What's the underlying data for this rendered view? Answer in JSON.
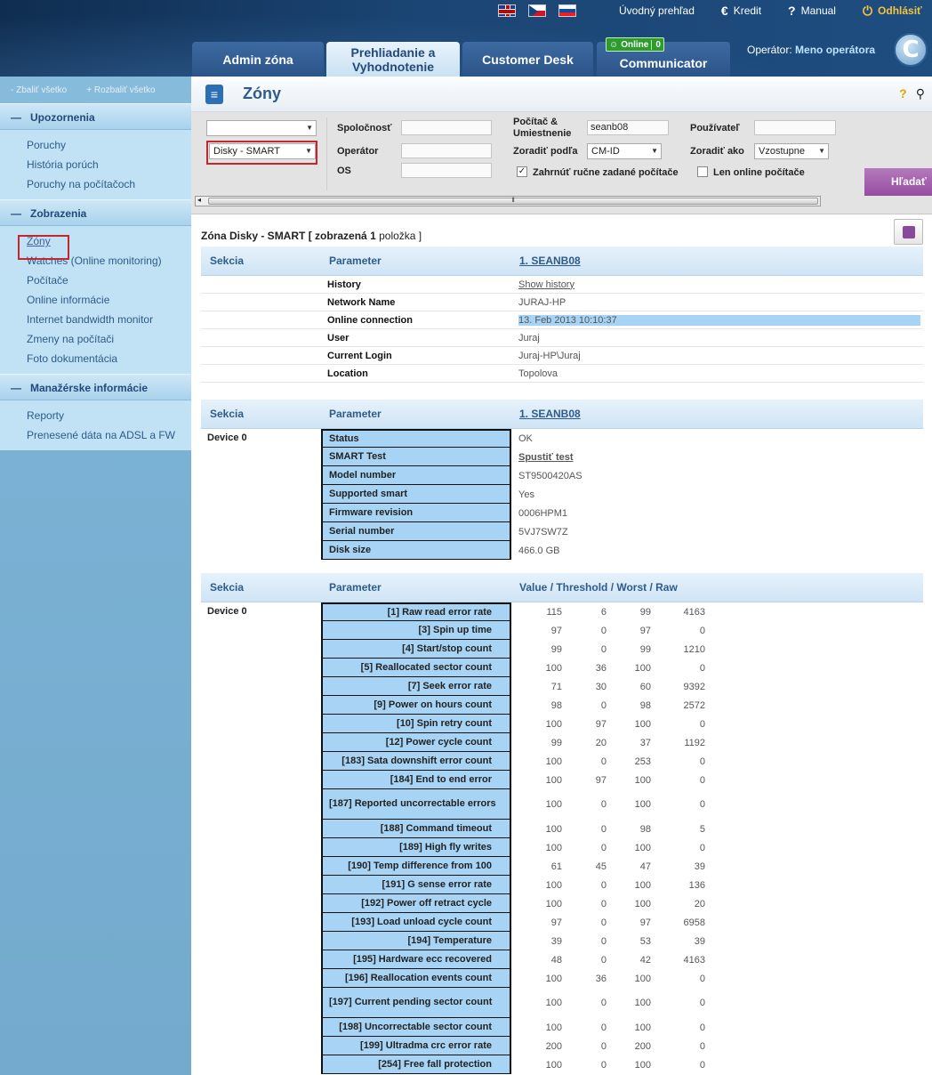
{
  "top_menu": {
    "flags": [
      "uk-flag-icon",
      "cz-flag-icon",
      "sk-flag-icon"
    ],
    "overview": "Úvodný prehľad",
    "credit": "Kredit",
    "manual": "Manual",
    "logout": "Odhlásiť"
  },
  "tabs": [
    {
      "label": "Admin zóna"
    },
    {
      "label": "Prehliadanie a Vyhodnotenie"
    },
    {
      "label": "Customer Desk"
    },
    {
      "label": "Communicator"
    }
  ],
  "online_badge": {
    "label": "Online",
    "count": "0"
  },
  "operator": {
    "label": "Operátor:",
    "name": "Meno operátora"
  },
  "logo_letter": "C",
  "sidebar": {
    "collapse_all": "Zbaliť všetko",
    "expand_all": "Rozbaliť všetko",
    "sections": [
      {
        "title": "Upozornenia",
        "items": [
          "Poruchy",
          "História porúch",
          "Poruchy na počítačoch"
        ]
      },
      {
        "title": "Zobrazenia",
        "items": [
          "Zóny",
          "Watches (Online monitoring)",
          "Počítače",
          "Online informácie",
          "Internet bandwidth monitor",
          "Zmeny na počítači",
          "Foto dokumentácia"
        ]
      },
      {
        "title": "Manažérske informácie",
        "items": [
          "Reporty",
          "Prenesené dáta na ADSL a FW"
        ]
      }
    ]
  },
  "page": {
    "title": "Zóny"
  },
  "filter": {
    "select1": "",
    "select2": "Disky - SMART",
    "company_label": "Spoločnosť",
    "operator_label": "Operátor",
    "os_label": "OS",
    "computer_label": "Počítač & Umiestnenie",
    "computer_value": "seanb08",
    "sort_by_label": "Zoradiť podľa",
    "sort_by_value": "CM-ID",
    "user_label": "Používateľ",
    "sort_order_label": "Zoradiť ako",
    "sort_order_value": "Vzostupne",
    "include_manual": "Zahrnúť ručne zadané počítače",
    "include_manual_checked": true,
    "online_only": "Len online počítače",
    "online_only_checked": false,
    "search_button": "Hľadať"
  },
  "zone": {
    "title": "Zóna Disky - SMART",
    "shown_prefix": "[ zobrazená",
    "shown_count": "1",
    "shown_suffix": "položka ]"
  },
  "headers": {
    "section": "Sekcia",
    "parameter": "Parameter",
    "computer": "1. SEANB08",
    "values": "Value / Threshold / Worst / Raw"
  },
  "info_rows": [
    {
      "param": "History",
      "value": "Show history"
    },
    {
      "param": "Network Name",
      "value": "JURAJ-HP"
    },
    {
      "param": "Online connection",
      "value": "13. Feb 2013 10:10:37"
    },
    {
      "param": "User",
      "value": "Juraj"
    },
    {
      "param": "Current Login",
      "value": "Juraj-HP\\Juraj"
    },
    {
      "param": "Location",
      "value": "Topolova"
    }
  ],
  "device_label": "Device 0",
  "device_rows": [
    {
      "param": "Status",
      "value": "OK"
    },
    {
      "param": "SMART Test",
      "value": "Spustiť test"
    },
    {
      "param": "Model number",
      "value": "ST9500420AS"
    },
    {
      "param": "Supported smart",
      "value": "Yes"
    },
    {
      "param": "Firmware revision",
      "value": "0006HPM1"
    },
    {
      "param": "Serial number",
      "value": "5VJ7SW7Z"
    },
    {
      "param": "Disk size",
      "value": "466.0 GB"
    }
  ],
  "smart_rows": [
    {
      "param": "[1] Raw read error rate",
      "v": "115",
      "t": "6",
      "w": "99",
      "r": "4163"
    },
    {
      "param": "[3] Spin up time",
      "v": "97",
      "t": "0",
      "w": "97",
      "r": "0"
    },
    {
      "param": "[4] Start/stop count",
      "v": "99",
      "t": "0",
      "w": "99",
      "r": "1210"
    },
    {
      "param": "[5] Reallocated sector count",
      "v": "100",
      "t": "36",
      "w": "100",
      "r": "0"
    },
    {
      "param": "[7] Seek error rate",
      "v": "71",
      "t": "30",
      "w": "60",
      "r": "9392"
    },
    {
      "param": "[9] Power on hours count",
      "v": "98",
      "t": "0",
      "w": "98",
      "r": "2572"
    },
    {
      "param": "[10] Spin retry count",
      "v": "100",
      "t": "97",
      "w": "100",
      "r": "0"
    },
    {
      "param": "[12] Power cycle count",
      "v": "99",
      "t": "20",
      "w": "37",
      "r": "1192"
    },
    {
      "param": "[183] Sata downshift error count",
      "v": "100",
      "t": "0",
      "w": "253",
      "r": "0"
    },
    {
      "param": "[184] End to end error",
      "v": "100",
      "t": "97",
      "w": "100",
      "r": "0"
    },
    {
      "param": "[187] Reported uncorrectable errors",
      "v": "100",
      "t": "0",
      "w": "100",
      "r": "0",
      "tall": true
    },
    {
      "param": "[188] Command timeout",
      "v": "100",
      "t": "0",
      "w": "98",
      "r": "5"
    },
    {
      "param": "[189] High fly writes",
      "v": "100",
      "t": "0",
      "w": "100",
      "r": "0"
    },
    {
      "param": "[190] Temp difference from 100",
      "v": "61",
      "t": "45",
      "w": "47",
      "r": "39"
    },
    {
      "param": "[191] G sense error rate",
      "v": "100",
      "t": "0",
      "w": "100",
      "r": "136"
    },
    {
      "param": "[192] Power off retract cycle",
      "v": "100",
      "t": "0",
      "w": "100",
      "r": "20"
    },
    {
      "param": "[193] Load unload cycle count",
      "v": "97",
      "t": "0",
      "w": "97",
      "r": "6958"
    },
    {
      "param": "[194] Temperature",
      "v": "39",
      "t": "0",
      "w": "53",
      "r": "39"
    },
    {
      "param": "[195] Hardware ecc recovered",
      "v": "48",
      "t": "0",
      "w": "42",
      "r": "4163"
    },
    {
      "param": "[196] Reallocation events count",
      "v": "100",
      "t": "36",
      "w": "100",
      "r": "0"
    },
    {
      "param": "[197] Current pending sector count",
      "v": "100",
      "t": "0",
      "w": "100",
      "r": "0",
      "tall": true
    },
    {
      "param": "[198] Uncorrectable sector count",
      "v": "100",
      "t": "0",
      "w": "100",
      "r": "0"
    },
    {
      "param": "[199] Ultradma crc error rate",
      "v": "200",
      "t": "0",
      "w": "200",
      "r": "0"
    },
    {
      "param": "[254] Free fall protection",
      "v": "100",
      "t": "0",
      "w": "100",
      "r": "0"
    }
  ]
}
